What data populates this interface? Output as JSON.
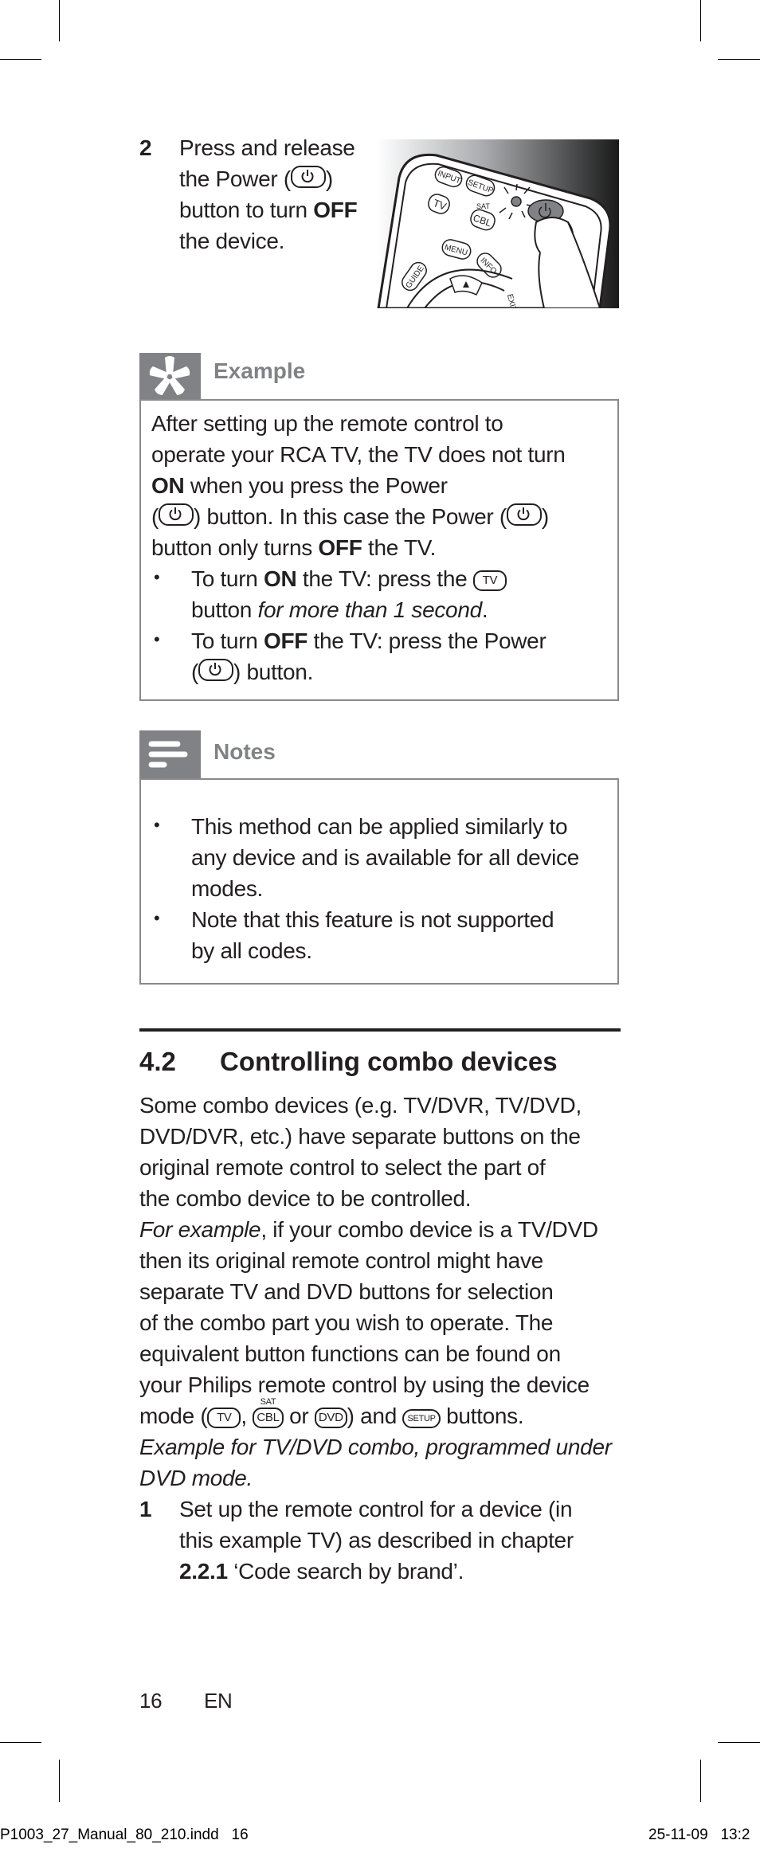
{
  "step2": {
    "number": "2",
    "lines": [
      {
        "text": "Press and release"
      },
      {
        "pre": "the Power (",
        "post": ")"
      },
      {
        "pre": "button to turn ",
        "bold": "OFF"
      },
      {
        "text": "the device."
      }
    ]
  },
  "illustration": {
    "buttons": [
      "INPUT",
      "SETUP",
      "TV",
      "SAT",
      "CBL",
      "MENU",
      "INFO",
      "GUIDE",
      "EXIT"
    ]
  },
  "example": {
    "title": "Example",
    "icon": "asterisk-icon",
    "lines": [
      {
        "text": "After setting up the remote control to"
      },
      {
        "text": "operate your RCA TV, the TV does not turn"
      },
      {
        "bold": "ON",
        "post": " when you press the Power"
      },
      {
        "pre": "(",
        "mid": ") button. In this case the Power (",
        "post": ")"
      },
      {
        "pre": "button only turns ",
        "bold": "OFF",
        "post": " the TV."
      }
    ],
    "bullets": [
      {
        "line1_pre": "To turn ",
        "line1_bold": "ON",
        "line1_mid": " the TV: press the ",
        "button": "TV",
        "line2_pre": "button ",
        "line2_italic": "for more than 1 second",
        "line2_post": "."
      },
      {
        "line1_pre": "To turn ",
        "line1_bold": "OFF",
        "line1_mid": " the TV: press the Power",
        "line2_pre": "(",
        "line2_post": ") button."
      }
    ]
  },
  "notes": {
    "title": "Notes",
    "icon": "notes-lines-icon",
    "bullets": [
      {
        "lines": [
          "This method can be applied similarly to",
          "any device and is available for all device",
          "modes."
        ]
      },
      {
        "lines": [
          "Note that this feature is not supported",
          "by all codes."
        ]
      }
    ]
  },
  "section": {
    "number": "4.2",
    "title": "Controlling combo devices",
    "paragraph": [
      "Some combo devices (e.g. TV/DVR, TV/DVD,",
      "DVD/DVR, etc.) have separate buttons on the",
      "original remote control to select the part of",
      "the combo device to be controlled."
    ],
    "example_para": {
      "italic_lead": "For example",
      "line1_rest": ", if your combo device is a TV/DVD",
      "lines": [
        "then its original remote control might have",
        "separate TV and DVD buttons for selection",
        "of the combo part you wish to operate. The",
        "equivalent button functions can be found on",
        "your Philips remote control by using the device"
      ],
      "mode_line": {
        "pre": "mode (",
        "b1": "TV",
        "sep1": ", ",
        "b2_sup": "SAT",
        "b2": "CBL",
        "sep2": " or ",
        "b3": "DVD",
        "sep3": ") and ",
        "b4": "SETUP",
        "post": " buttons."
      }
    },
    "italic_note": [
      "Example for TV/DVD combo, programmed under",
      "DVD mode."
    ],
    "step1": {
      "number": "1",
      "lines": [
        "Set up the remote control for a device (in",
        "this example TV) as described in chapter"
      ],
      "last_bold": "2.2.1",
      "last_rest": " ‘Code search by brand’."
    }
  },
  "page_footer": {
    "page_number": "16",
    "language": "EN"
  },
  "slug": {
    "filename": "P1003_27_Manual_80_210.indd   16",
    "datetime": "25-11-09   13:2"
  }
}
